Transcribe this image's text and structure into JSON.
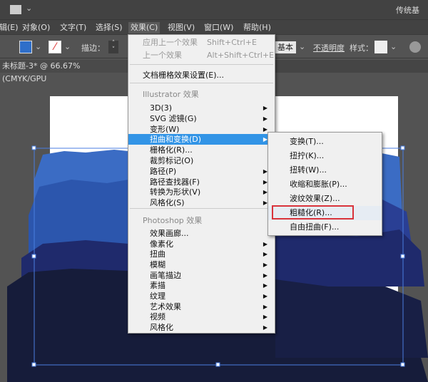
{
  "topbar": {
    "workspace": "传统基"
  },
  "menubar": [
    {
      "label": "辑(E)"
    },
    {
      "label": "对象(O)"
    },
    {
      "label": "文字(T)"
    },
    {
      "label": "选择(S)"
    },
    {
      "label": "效果(C)"
    },
    {
      "label": "视图(V)"
    },
    {
      "label": "窗口(W)"
    },
    {
      "label": "帮助(H)"
    }
  ],
  "control": {
    "stroke_label": "描边：",
    "brush": "基本",
    "opacity": "不透明度",
    "style": "样式：",
    "fill_color": "#2f6fc9"
  },
  "document": {
    "tab": "未标题-3* @ 66.67% (CMYK/GPU"
  },
  "effect_menu": [
    {
      "label": "应用上一个效果",
      "shortcut": "Shift+Ctrl+E",
      "type": "dis"
    },
    {
      "label": "上一个效果",
      "shortcut": "Alt+Shift+Ctrl+E",
      "type": "dis"
    },
    {
      "type": "sep"
    },
    {
      "label": "文档栅格效果设置(E)..."
    },
    {
      "type": "sep"
    },
    {
      "label": "Illustrator 效果",
      "type": "hdr"
    },
    {
      "label": "3D(3)",
      "sub": true
    },
    {
      "label": "SVG 滤镜(G)",
      "sub": true
    },
    {
      "label": "变形(W)",
      "sub": true
    },
    {
      "label": "扭曲和变换(D)",
      "sub": true,
      "type": "hl"
    },
    {
      "label": "栅格化(R)..."
    },
    {
      "label": "裁剪标记(O)"
    },
    {
      "label": "路径(P)",
      "sub": true
    },
    {
      "label": "路径查找器(F)",
      "sub": true
    },
    {
      "label": "转换为形状(V)",
      "sub": true
    },
    {
      "label": "风格化(S)",
      "sub": true
    },
    {
      "type": "sep"
    },
    {
      "label": "Photoshop 效果",
      "type": "hdr"
    },
    {
      "label": "效果画廊..."
    },
    {
      "label": "像素化",
      "sub": true
    },
    {
      "label": "扭曲",
      "sub": true
    },
    {
      "label": "模糊",
      "sub": true
    },
    {
      "label": "画笔描边",
      "sub": true
    },
    {
      "label": "素描",
      "sub": true
    },
    {
      "label": "纹理",
      "sub": true
    },
    {
      "label": "艺术效果",
      "sub": true
    },
    {
      "label": "视频",
      "sub": true
    },
    {
      "label": "风格化",
      "sub": true
    }
  ],
  "distort_submenu": [
    {
      "label": "变换(T)..."
    },
    {
      "label": "扭拧(K)..."
    },
    {
      "label": "扭转(W)..."
    },
    {
      "label": "收缩和膨胀(P)..."
    },
    {
      "label": "波纹效果(Z)..."
    },
    {
      "label": "粗糙化(R)...",
      "highlighted": true
    },
    {
      "label": "自由扭曲(F)..."
    }
  ],
  "colors": {
    "highlight": "#3294e6",
    "annotation": "#d9333b"
  }
}
